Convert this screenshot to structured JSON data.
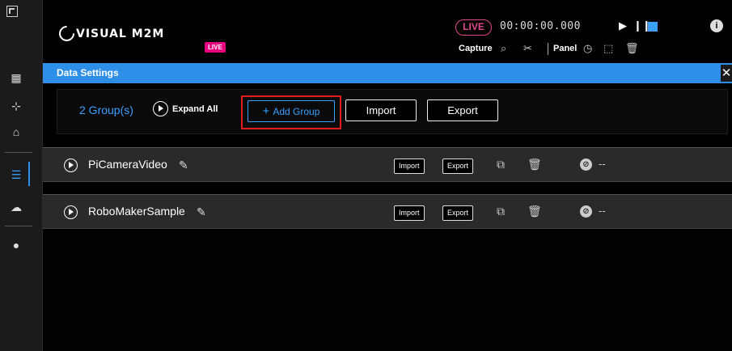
{
  "app": {
    "logo_text": "VISUAL M2M",
    "live_tag": "LIVE"
  },
  "header": {
    "live_pill": "LIVE",
    "timecode": "00:00:00.000",
    "capture_label": "Capture",
    "panel_label": "Panel",
    "info_glyph": "i"
  },
  "data_settings": {
    "title": "Data Settings",
    "close_glyph": "✕",
    "groups_count": "2 Group(s)",
    "expand_all": "Expand All",
    "add_group": "Add Group",
    "add_glyph": "+",
    "import_label": "Import",
    "export_label": "Export"
  },
  "groups": [
    {
      "name": "PiCameraVideo",
      "import_label": "Import",
      "export_label": "Export",
      "status": "--"
    },
    {
      "name": "RoboMakerSample",
      "import_label": "Import",
      "export_label": "Export",
      "status": "--"
    }
  ],
  "colors": {
    "accent": "#2d8fe8",
    "live": "#e8007e",
    "highlight": "#e01e1e"
  }
}
